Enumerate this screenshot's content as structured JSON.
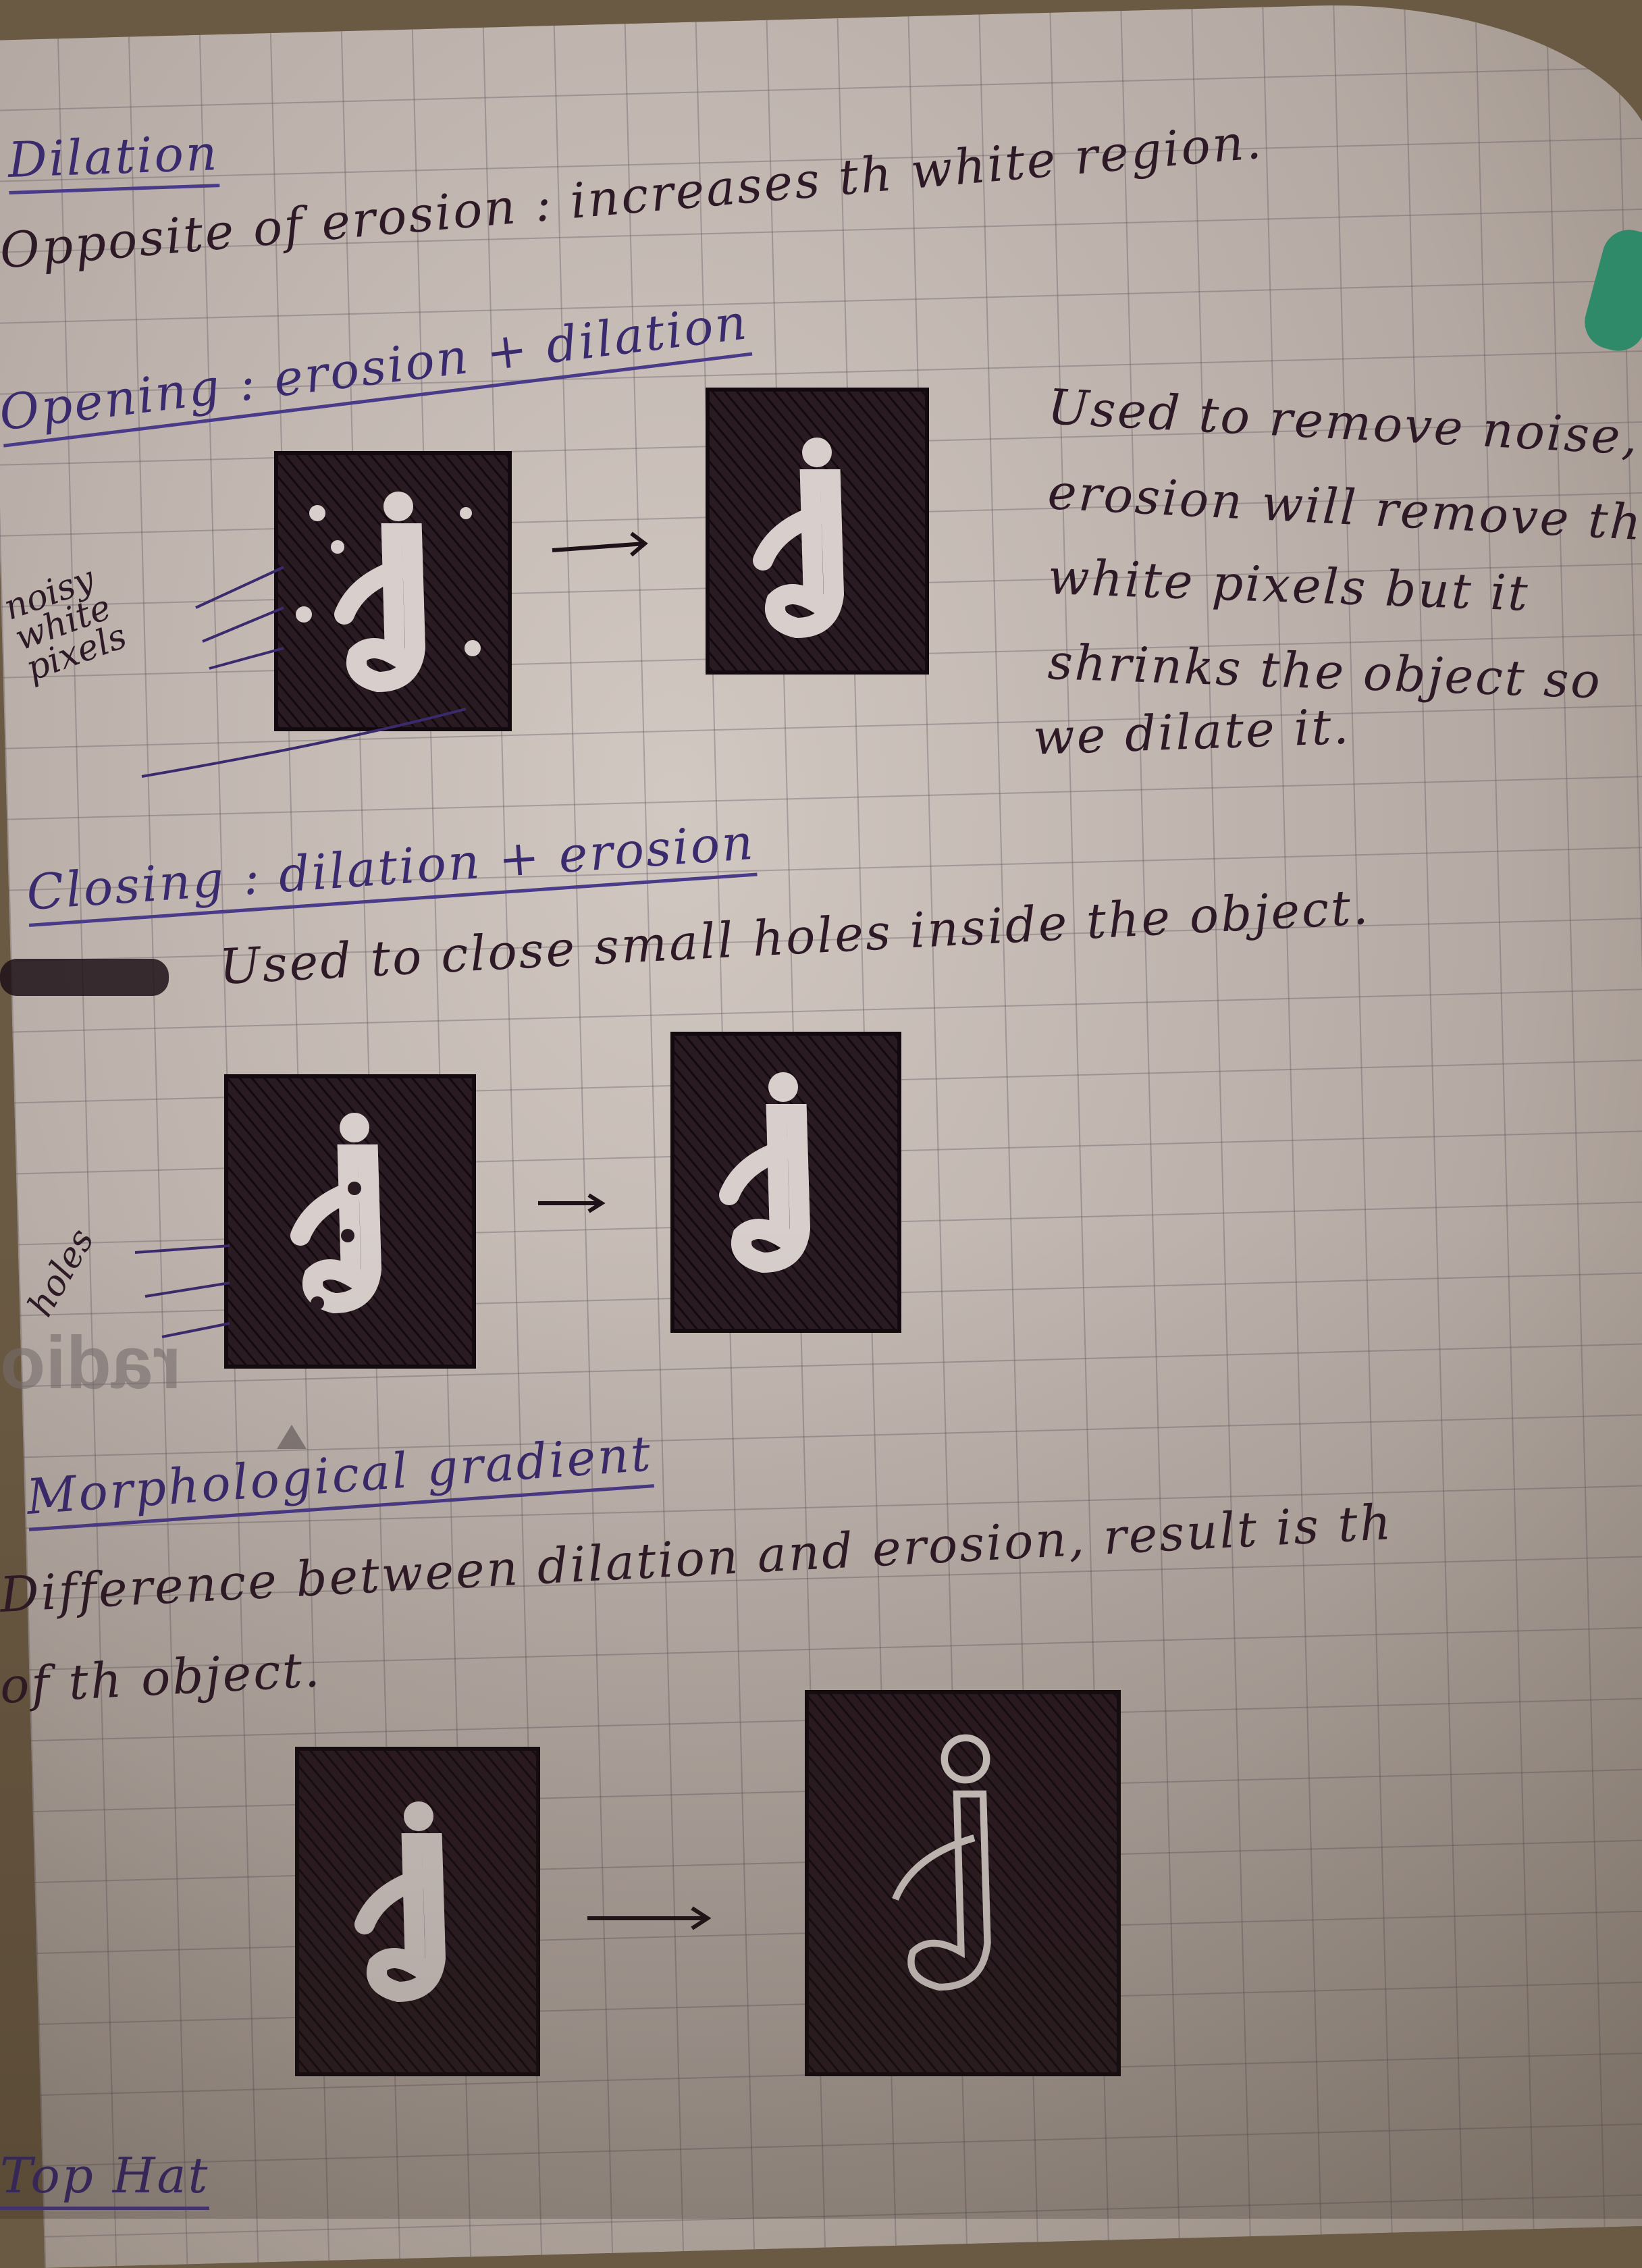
{
  "sections": {
    "dilation": {
      "heading": "Dilation",
      "text": "Opposite of erosion : increases th white region."
    },
    "opening": {
      "heading": "Opening : erosion + dilation",
      "side_label": "noisy white pixels",
      "notes": [
        "Used to remove noise,",
        "erosion will remove the",
        "white pixels but it",
        "shrinks the object so",
        "we dilate it."
      ]
    },
    "closing": {
      "heading": "Closing : dilation + erosion",
      "text": "Used to close small holes inside the object.",
      "side_label": "holes"
    },
    "gradient": {
      "heading": "Morphological gradient",
      "lines": [
        "Difference between dilation and erosion, result is th",
        "of th object."
      ]
    },
    "tophat": {
      "heading": "Top Hat"
    }
  },
  "watermark": "radio",
  "ink_colors": {
    "heading": "#3a2a6e",
    "text": "#2e1a26",
    "sketch": "#1e1218"
  }
}
